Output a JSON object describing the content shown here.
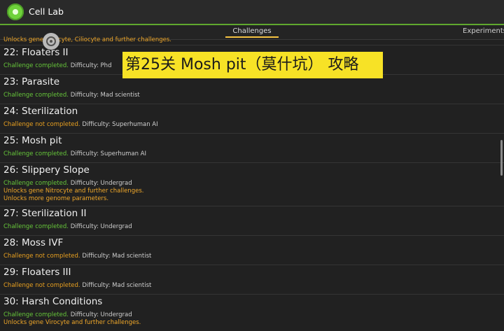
{
  "app": {
    "title": "Cell Lab"
  },
  "tabs": [
    {
      "label": "Challenges"
    },
    {
      "label": "Experiments"
    }
  ],
  "overlay": {
    "banner_text": "第25关 Mosh pit（莫什坑） 攻略"
  },
  "partial_row": {
    "unlock_text": "Unlocks gene Ciliocyte, Ciliocyte and further challenges."
  },
  "rows": [
    {
      "title": "22: Floaters II",
      "status": "Challenge completed.",
      "difficulty": "Difficulty: Phd"
    },
    {
      "title": "23: Parasite",
      "status": "Challenge completed.",
      "difficulty": "Difficulty: Mad scientist"
    },
    {
      "title": "24: Sterilization",
      "status": "Challenge not completed.",
      "difficulty": "Difficulty: Superhuman AI"
    },
    {
      "title": "25: Mosh pit",
      "status": "Challenge completed.",
      "difficulty": "Difficulty: Superhuman AI"
    },
    {
      "title": "26: Slippery Slope",
      "status": "Challenge completed.",
      "difficulty": "Difficulty: Undergrad",
      "unlock_1": "Unlocks gene Nitrocyte and further challenges.",
      "unlock_2": "Unlocks more genome parameters."
    },
    {
      "title": "27: Sterilization II",
      "status": "Challenge completed.",
      "difficulty": "Difficulty: Undergrad"
    },
    {
      "title": "28: Moss IVF",
      "status": "Challenge not completed.",
      "difficulty": "Difficulty: Mad scientist"
    },
    {
      "title": "29: Floaters III",
      "status": "Challenge not completed.",
      "difficulty": "Difficulty: Mad scientist"
    },
    {
      "title": "30: Harsh Conditions",
      "status": "Challenge completed.",
      "difficulty": "Difficulty: Undergrad",
      "unlock_1": "Unlocks gene Virocyte and further challenges."
    }
  ],
  "colors": {
    "accent_green": "#66c63a",
    "accent_orange": "#f0a82a",
    "banner_yellow": "#f7e226",
    "tab_underline": "#f5c242"
  },
  "icons": {
    "logo": "cell-lab-logo-icon",
    "target": "target-icon"
  }
}
